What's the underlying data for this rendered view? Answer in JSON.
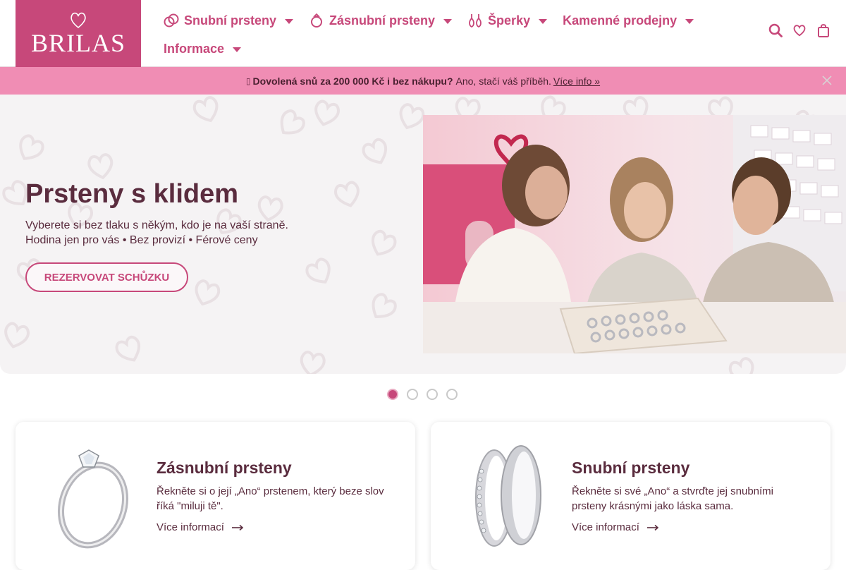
{
  "header": {
    "logo_text": "BRILAS",
    "nav": [
      {
        "label": "Snubní prsteny",
        "icon": "rings-icon"
      },
      {
        "label": "Zásnubní prsteny",
        "icon": "engagement-ring-icon"
      },
      {
        "label": "Šperky",
        "icon": "earrings-icon"
      },
      {
        "label": "Kamenné prodejny",
        "icon": ""
      },
      {
        "label": "Informace",
        "icon": ""
      }
    ],
    "tools": [
      "search-icon",
      "heart-icon",
      "bag-icon"
    ]
  },
  "promo": {
    "icon": "gift-icon",
    "bold": "Dovolená snů za 200 000 Kč i bez nákupu?",
    "text": "Ano, stačí váš příběh.",
    "link": "Více info »"
  },
  "hero": {
    "title": "Prsteny s klidem",
    "subtitle_line1": "Vyberete si bez tlaku s někým, kdo je na vaší straně.",
    "subtitle_line2": "Hodina jen pro vás • Bez provizí • Férové ceny",
    "button": "REZERVOVAT SCHŮZKU"
  },
  "slider": {
    "count": 4,
    "active": 1
  },
  "cards": [
    {
      "title": "Zásnubní prsteny",
      "text": "Řekněte si o její „Ano“ prstenem, který beze slov říká \"miluji tě\".",
      "link": "Více informací"
    },
    {
      "title": "Snubní prsteny",
      "text": "Řekněte si své „Ano“ a stvrďte jej snubními prsteny krásnými jako láska sama.",
      "link": "Více informací"
    }
  ],
  "colors": {
    "brand": "#c7487a",
    "promo_bg": "#f08db4",
    "text": "#5a2c3e"
  }
}
